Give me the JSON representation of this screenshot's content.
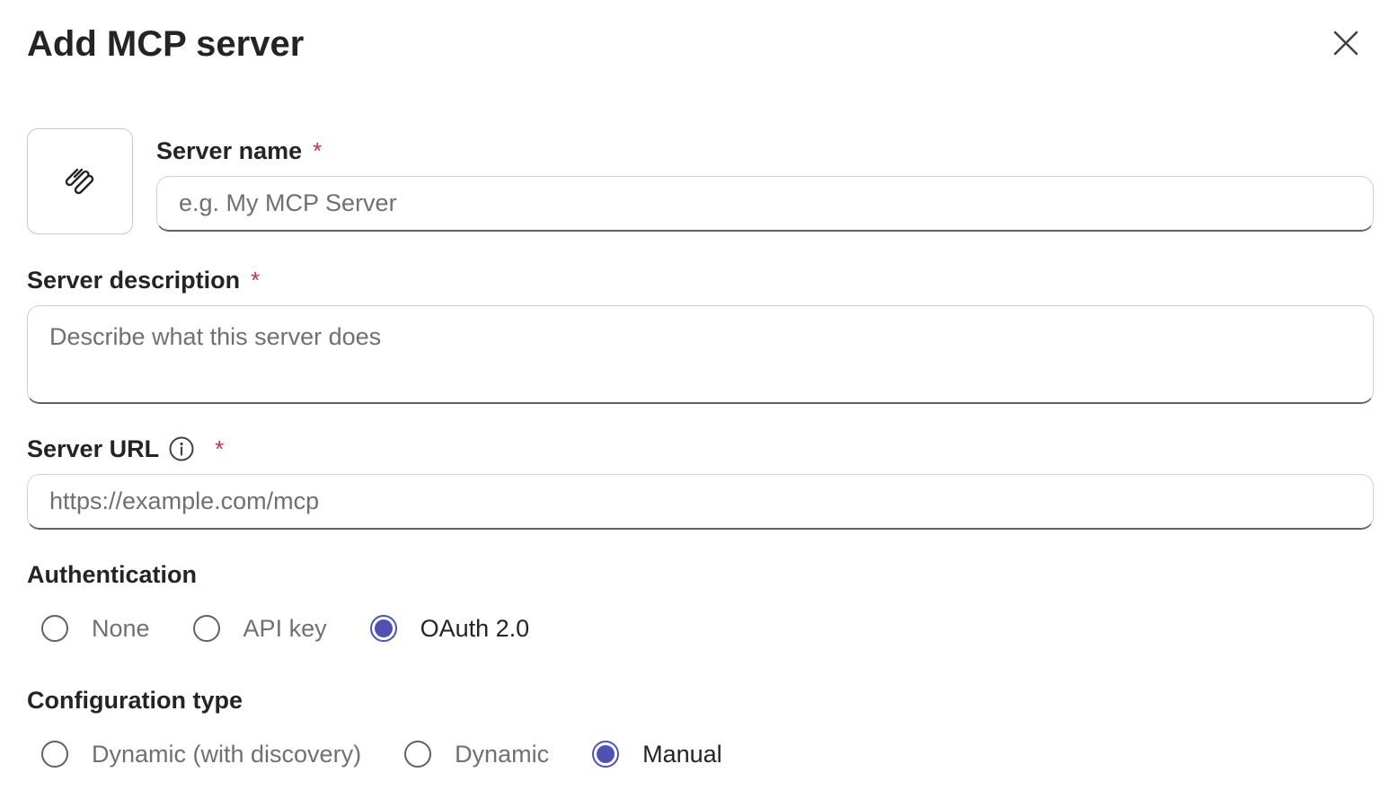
{
  "dialog": {
    "title": "Add MCP server",
    "close_icon": "close-icon",
    "server_icon": "paperclip-icon"
  },
  "form": {
    "server_name": {
      "label": "Server name",
      "required_mark": "*",
      "placeholder": "e.g. My MCP Server",
      "value": ""
    },
    "server_description": {
      "label": "Server description",
      "required_mark": "*",
      "placeholder": "Describe what this server does",
      "value": ""
    },
    "server_url": {
      "label": "Server URL",
      "info_icon": "info-icon",
      "required_mark": "*",
      "placeholder": "https://example.com/mcp",
      "value": ""
    },
    "authentication": {
      "label": "Authentication",
      "options": [
        {
          "label": "None",
          "selected": false
        },
        {
          "label": "API key",
          "selected": false
        },
        {
          "label": "OAuth 2.0",
          "selected": true
        }
      ]
    },
    "configuration_type": {
      "label": "Configuration type",
      "options": [
        {
          "label": "Dynamic (with discovery)",
          "selected": false
        },
        {
          "label": "Dynamic",
          "selected": false
        },
        {
          "label": "Manual",
          "selected": true
        }
      ]
    }
  },
  "colors": {
    "accent": "#4f52b2",
    "required": "#c4314b",
    "text": "#242424",
    "placeholder": "#707070",
    "border": "#d1d1d1"
  }
}
